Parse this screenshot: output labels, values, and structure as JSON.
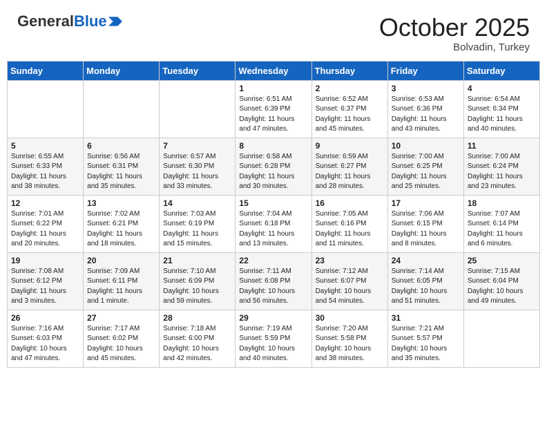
{
  "header": {
    "logo_general": "General",
    "logo_blue": "Blue",
    "month_title": "October 2025",
    "location": "Bolvadin, Turkey"
  },
  "days_of_week": [
    "Sunday",
    "Monday",
    "Tuesday",
    "Wednesday",
    "Thursday",
    "Friday",
    "Saturday"
  ],
  "weeks": [
    [
      {
        "day": "",
        "info": ""
      },
      {
        "day": "",
        "info": ""
      },
      {
        "day": "",
        "info": ""
      },
      {
        "day": "1",
        "info": "Sunrise: 6:51 AM\nSunset: 6:39 PM\nDaylight: 11 hours\nand 47 minutes."
      },
      {
        "day": "2",
        "info": "Sunrise: 6:52 AM\nSunset: 6:37 PM\nDaylight: 11 hours\nand 45 minutes."
      },
      {
        "day": "3",
        "info": "Sunrise: 6:53 AM\nSunset: 6:36 PM\nDaylight: 11 hours\nand 43 minutes."
      },
      {
        "day": "4",
        "info": "Sunrise: 6:54 AM\nSunset: 6:34 PM\nDaylight: 11 hours\nand 40 minutes."
      }
    ],
    [
      {
        "day": "5",
        "info": "Sunrise: 6:55 AM\nSunset: 6:33 PM\nDaylight: 11 hours\nand 38 minutes."
      },
      {
        "day": "6",
        "info": "Sunrise: 6:56 AM\nSunset: 6:31 PM\nDaylight: 11 hours\nand 35 minutes."
      },
      {
        "day": "7",
        "info": "Sunrise: 6:57 AM\nSunset: 6:30 PM\nDaylight: 11 hours\nand 33 minutes."
      },
      {
        "day": "8",
        "info": "Sunrise: 6:58 AM\nSunset: 6:28 PM\nDaylight: 11 hours\nand 30 minutes."
      },
      {
        "day": "9",
        "info": "Sunrise: 6:59 AM\nSunset: 6:27 PM\nDaylight: 11 hours\nand 28 minutes."
      },
      {
        "day": "10",
        "info": "Sunrise: 7:00 AM\nSunset: 6:25 PM\nDaylight: 11 hours\nand 25 minutes."
      },
      {
        "day": "11",
        "info": "Sunrise: 7:00 AM\nSunset: 6:24 PM\nDaylight: 11 hours\nand 23 minutes."
      }
    ],
    [
      {
        "day": "12",
        "info": "Sunrise: 7:01 AM\nSunset: 6:22 PM\nDaylight: 11 hours\nand 20 minutes."
      },
      {
        "day": "13",
        "info": "Sunrise: 7:02 AM\nSunset: 6:21 PM\nDaylight: 11 hours\nand 18 minutes."
      },
      {
        "day": "14",
        "info": "Sunrise: 7:03 AM\nSunset: 6:19 PM\nDaylight: 11 hours\nand 15 minutes."
      },
      {
        "day": "15",
        "info": "Sunrise: 7:04 AM\nSunset: 6:18 PM\nDaylight: 11 hours\nand 13 minutes."
      },
      {
        "day": "16",
        "info": "Sunrise: 7:05 AM\nSunset: 6:16 PM\nDaylight: 11 hours\nand 11 minutes."
      },
      {
        "day": "17",
        "info": "Sunrise: 7:06 AM\nSunset: 6:15 PM\nDaylight: 11 hours\nand 8 minutes."
      },
      {
        "day": "18",
        "info": "Sunrise: 7:07 AM\nSunset: 6:14 PM\nDaylight: 11 hours\nand 6 minutes."
      }
    ],
    [
      {
        "day": "19",
        "info": "Sunrise: 7:08 AM\nSunset: 6:12 PM\nDaylight: 11 hours\nand 3 minutes."
      },
      {
        "day": "20",
        "info": "Sunrise: 7:09 AM\nSunset: 6:11 PM\nDaylight: 11 hours\nand 1 minute."
      },
      {
        "day": "21",
        "info": "Sunrise: 7:10 AM\nSunset: 6:09 PM\nDaylight: 10 hours\nand 59 minutes."
      },
      {
        "day": "22",
        "info": "Sunrise: 7:11 AM\nSunset: 6:08 PM\nDaylight: 10 hours\nand 56 minutes."
      },
      {
        "day": "23",
        "info": "Sunrise: 7:12 AM\nSunset: 6:07 PM\nDaylight: 10 hours\nand 54 minutes."
      },
      {
        "day": "24",
        "info": "Sunrise: 7:14 AM\nSunset: 6:05 PM\nDaylight: 10 hours\nand 51 minutes."
      },
      {
        "day": "25",
        "info": "Sunrise: 7:15 AM\nSunset: 6:04 PM\nDaylight: 10 hours\nand 49 minutes."
      }
    ],
    [
      {
        "day": "26",
        "info": "Sunrise: 7:16 AM\nSunset: 6:03 PM\nDaylight: 10 hours\nand 47 minutes."
      },
      {
        "day": "27",
        "info": "Sunrise: 7:17 AM\nSunset: 6:02 PM\nDaylight: 10 hours\nand 45 minutes."
      },
      {
        "day": "28",
        "info": "Sunrise: 7:18 AM\nSunset: 6:00 PM\nDaylight: 10 hours\nand 42 minutes."
      },
      {
        "day": "29",
        "info": "Sunrise: 7:19 AM\nSunset: 5:59 PM\nDaylight: 10 hours\nand 40 minutes."
      },
      {
        "day": "30",
        "info": "Sunrise: 7:20 AM\nSunset: 5:58 PM\nDaylight: 10 hours\nand 38 minutes."
      },
      {
        "day": "31",
        "info": "Sunrise: 7:21 AM\nSunset: 5:57 PM\nDaylight: 10 hours\nand 35 minutes."
      },
      {
        "day": "",
        "info": ""
      }
    ]
  ]
}
